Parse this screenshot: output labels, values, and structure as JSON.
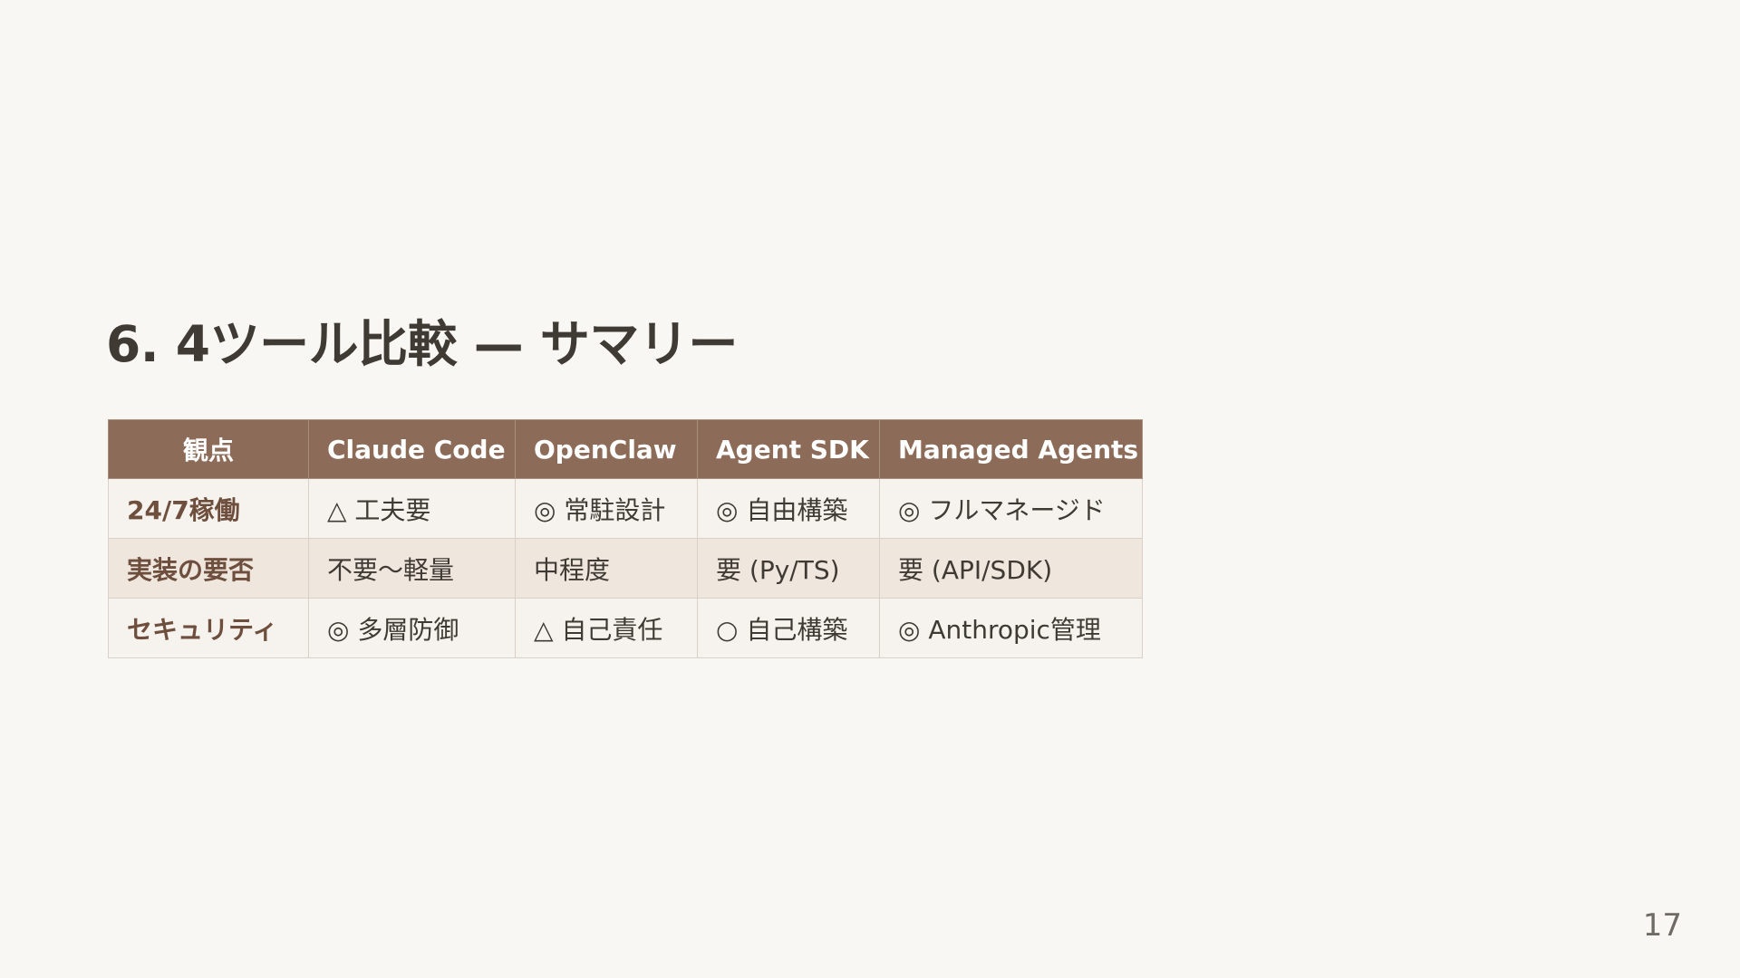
{
  "slide": {
    "title": "6. 4ツール比較 — サマリー",
    "page_number": "17"
  },
  "table": {
    "headers": [
      "観点",
      "Claude Code",
      "OpenClaw",
      "Agent SDK",
      "Managed Agents"
    ],
    "rows": [
      [
        "24/7稼働",
        "△ 工夫要",
        "◎ 常駐設計",
        "◎ 自由構築",
        "◎ フルマネージド"
      ],
      [
        "実装の要否",
        "不要〜軽量",
        "中程度",
        "要 (Py/TS)",
        "要 (API/SDK)"
      ],
      [
        "セキュリティ",
        "◎ 多層防御",
        "△ 自己責任",
        "○ 自己構築",
        "◎ Anthropic管理"
      ]
    ]
  },
  "colors": {
    "header_background": "#8c6b58",
    "row_label_text": "#6e4e3c",
    "page_background": "#f9f7f4"
  }
}
